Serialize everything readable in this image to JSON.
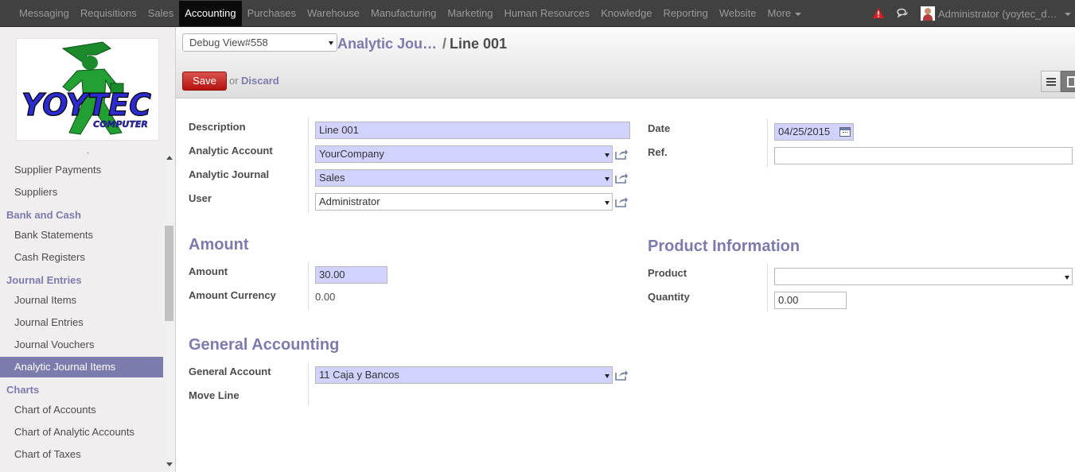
{
  "topbar": {
    "menu": [
      "Messaging",
      "Requisitions",
      "Sales",
      "Accounting",
      "Purchases",
      "Warehouse",
      "Manufacturing",
      "Marketing",
      "Human Resources",
      "Knowledge",
      "Reporting",
      "Website",
      "More"
    ],
    "active": "Accounting",
    "user": "Administrator (yoytec_d…"
  },
  "sidebar": {
    "dot": ".",
    "items": [
      {
        "type": "item",
        "label": "Supplier Payments"
      },
      {
        "type": "item",
        "label": "Suppliers"
      },
      {
        "type": "head",
        "label": "Bank and Cash"
      },
      {
        "type": "item",
        "label": "Bank Statements"
      },
      {
        "type": "item",
        "label": "Cash Registers"
      },
      {
        "type": "head",
        "label": "Journal Entries"
      },
      {
        "type": "item",
        "label": "Journal Items"
      },
      {
        "type": "item",
        "label": "Journal Entries"
      },
      {
        "type": "item",
        "label": "Journal Vouchers"
      },
      {
        "type": "item",
        "label": "Analytic Journal Items",
        "selected": true
      },
      {
        "type": "head",
        "label": "Charts"
      },
      {
        "type": "item",
        "label": "Chart of Accounts"
      },
      {
        "type": "item",
        "label": "Chart of Analytic Accounts"
      },
      {
        "type": "item",
        "label": "Chart of Taxes"
      }
    ]
  },
  "control_panel": {
    "debug_view": "Debug View#558",
    "breadcrumb_parent": "Analytic Jou…",
    "breadcrumb_sep": "/",
    "breadcrumb_current": "Line 001",
    "save_label": "Save",
    "or_label": "or",
    "discard_label": "Discard"
  },
  "form": {
    "description_label": "Description",
    "description_value": "Line 001",
    "analytic_account_label": "Analytic Account",
    "analytic_account_value": "YourCompany",
    "analytic_journal_label": "Analytic Journal",
    "analytic_journal_value": "Sales",
    "user_label": "User",
    "user_value": "Administrator",
    "date_label": "Date",
    "date_value": "04/25/2015",
    "ref_label": "Ref.",
    "ref_value": "",
    "amount_section": "Amount",
    "amount_label": "Amount",
    "amount_value": "30.00",
    "amount_currency_label": "Amount Currency",
    "amount_currency_value": "0.00",
    "product_section": "Product Information",
    "product_label": "Product",
    "product_value": "",
    "quantity_label": "Quantity",
    "quantity_value": "0.00",
    "general_section": "General Accounting",
    "general_account_label": "General Account",
    "general_account_value": "11 Caja y Bancos",
    "move_line_label": "Move Line"
  },
  "colors": {
    "topbar": "#414141",
    "accent": "#7c7bad",
    "required_field": "#d2d2ff",
    "save_button": "#c9302c"
  }
}
